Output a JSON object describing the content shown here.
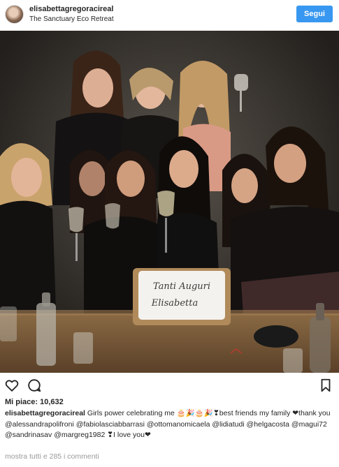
{
  "post": {
    "username": "elisabettagregoracireal",
    "location": "The Sanctuary Eco Retreat",
    "follow_label": "Segui",
    "cake_text_line1": "Tanti Auguri",
    "cake_text_line2": "Elisabetta",
    "likes_text": "Mi piace: 10,632",
    "caption_username": "elisabettagregoracireal",
    "caption_text": "Girls power celebrating me 🎂🎉🎂🎉❣best friends my family ❤thank you @alessandrapolifroni @fabiolasciabbarrasi @ottomanomicaela @lidiatudi @helgacosta @magui72 @sandrinasav @margreg1982 ❣I love you❤",
    "comments_link": "mostra tutti e 285 i commenti"
  },
  "icons": {
    "like": "heart-outline-icon",
    "comment": "speech-bubble-icon",
    "save": "bookmark-icon"
  },
  "colors": {
    "follow_button": "#3897f0",
    "text": "#262626",
    "muted": "#999999"
  }
}
